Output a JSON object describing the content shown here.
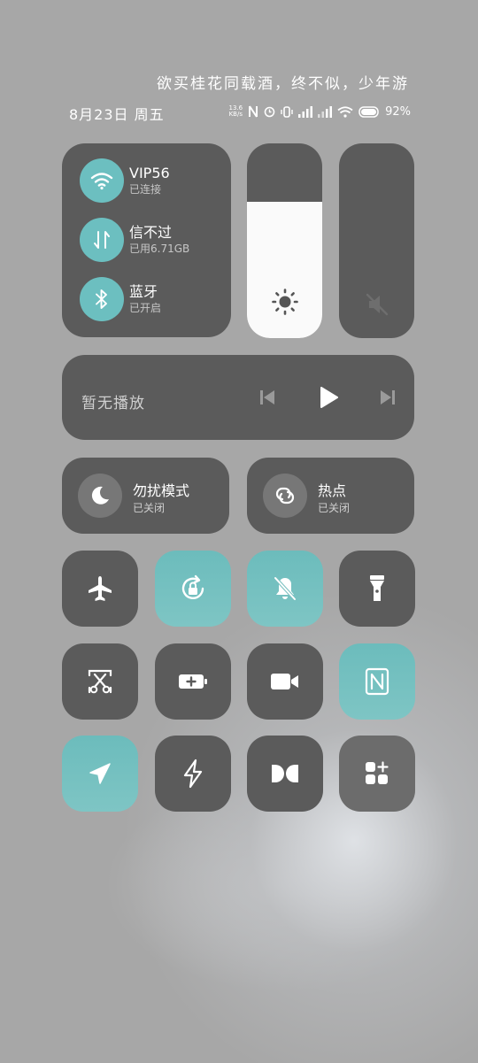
{
  "header": {
    "poem": "欲买桂花同载酒，终不似，少年游",
    "date": "8月23日  周五",
    "net_speed_value": "13.6",
    "net_speed_unit": "KB/s",
    "battery_percent": "92%"
  },
  "network": {
    "wifi": {
      "title": "VIP56",
      "status": "已连接",
      "icon": "wifi-icon"
    },
    "mobile": {
      "title": "信不过",
      "status": "已用6.71GB",
      "icon": "mobile-data-icon"
    },
    "bluetooth": {
      "title": "蓝牙",
      "status": "已开启",
      "icon": "bluetooth-icon"
    }
  },
  "brightness": {
    "level": 0.7,
    "icon": "sun-icon"
  },
  "volume": {
    "level": 0,
    "icon": "mute-icon"
  },
  "media": {
    "label": "暂无播放"
  },
  "dnd": {
    "title": "勿扰模式",
    "status": "已关闭",
    "icon": "moon-icon"
  },
  "hotspot": {
    "title": "热点",
    "status": "已关闭",
    "icon": "link-icon"
  },
  "toggles": [
    {
      "name": "airplane",
      "active": false
    },
    {
      "name": "rotation-lock",
      "active": true
    },
    {
      "name": "silent",
      "active": true
    },
    {
      "name": "flashlight",
      "active": false
    },
    {
      "name": "screenshot",
      "active": false
    },
    {
      "name": "battery-saver",
      "active": false
    },
    {
      "name": "screen-record",
      "active": false
    },
    {
      "name": "nfc",
      "active": true
    },
    {
      "name": "location",
      "active": true
    },
    {
      "name": "power-mode",
      "active": false
    },
    {
      "name": "dolby",
      "active": false
    },
    {
      "name": "edit-controls",
      "active": false
    }
  ],
  "colors": {
    "accent": "#6cbfc0",
    "card": "#5b5b5b",
    "background": "#a7a7a7"
  }
}
